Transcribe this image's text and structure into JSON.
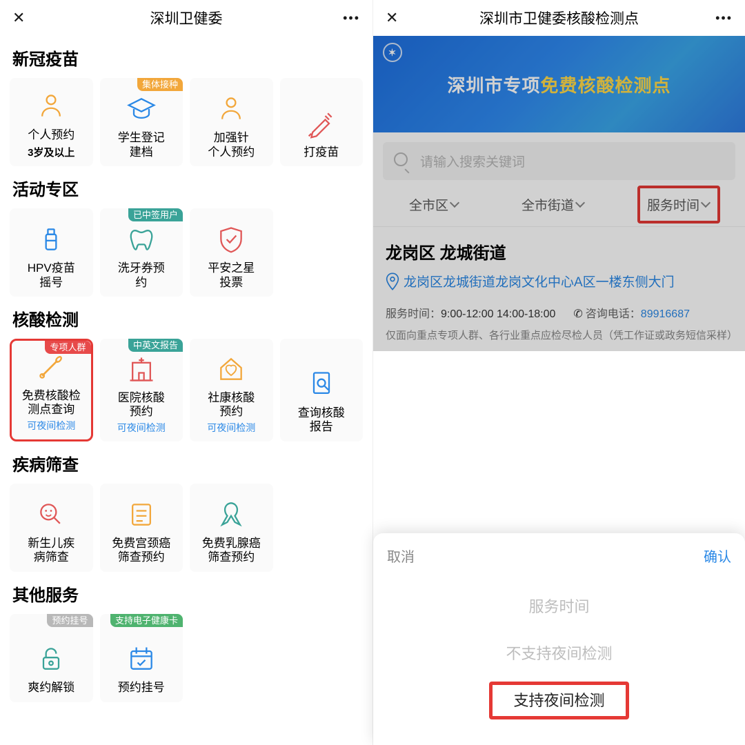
{
  "left": {
    "title": "深圳卫健委",
    "sections": [
      {
        "title": "新冠疫苗",
        "tiles": [
          {
            "id": "personal-appoint",
            "l1": "个人预约",
            "l2": "",
            "sub": "3岁及以上",
            "badge": null,
            "icon": "person",
            "iconColor": "#f2a73b"
          },
          {
            "id": "student-reg",
            "l1": "学生登记",
            "l2": "建档",
            "badge": "集体接种",
            "badgeColor": "orange",
            "icon": "gradhat",
            "iconColor": "#2a88e6"
          },
          {
            "id": "booster-appoint",
            "l1": "加强针",
            "l2": "个人预约",
            "badge": null,
            "icon": "person",
            "iconColor": "#f2a73b"
          },
          {
            "id": "vaccinate",
            "l1": "打疫苗",
            "l2": "",
            "badge": null,
            "icon": "syringe",
            "iconColor": "#e05757"
          }
        ]
      },
      {
        "title": "活动专区",
        "tiles": [
          {
            "id": "hpv-lottery",
            "l1": "HPV疫苗",
            "l2": "摇号",
            "badge": null,
            "icon": "bottle",
            "iconColor": "#2a88e6"
          },
          {
            "id": "dental-appoint",
            "l1": "洗牙券预",
            "l2": "约",
            "badge": "已中签用户",
            "badgeColor": "teal",
            "icon": "tooth",
            "iconColor": "#3aa398"
          },
          {
            "id": "pingan-vote",
            "l1": "平安之星",
            "l2": "投票",
            "badge": null,
            "icon": "shield",
            "iconColor": "#e05757"
          }
        ]
      },
      {
        "title": "核酸检测",
        "tiles": [
          {
            "id": "free-test-lookup",
            "l1": "免费核酸检",
            "l2": "测点查询",
            "note": "可夜间检测",
            "badge": "专项人群",
            "badgeColor": "red",
            "icon": "swab",
            "iconColor": "#f2a73b",
            "highlight": true
          },
          {
            "id": "hospital-test",
            "l1": "医院核酸",
            "l2": "预约",
            "note": "可夜间检测",
            "badge": "中英文报告",
            "badgeColor": "teal",
            "icon": "hospital",
            "iconColor": "#e05757"
          },
          {
            "id": "community-test",
            "l1": "社康核酸",
            "l2": "预约",
            "note": "可夜间检测",
            "badge": null,
            "icon": "house-heart",
            "iconColor": "#f2a73b"
          },
          {
            "id": "query-report",
            "l1": "查询核酸",
            "l2": "报告",
            "badge": null,
            "icon": "doc-search",
            "iconColor": "#2a88e6"
          }
        ]
      },
      {
        "title": "疾病筛查",
        "tiles": [
          {
            "id": "newborn-screen",
            "l1": "新生儿疾",
            "l2": "病筛查",
            "badge": null,
            "icon": "baby-search",
            "iconColor": "#e05757"
          },
          {
            "id": "cervical-screen",
            "l1": "免费宫颈癌",
            "l2": "筛查预约",
            "badge": null,
            "icon": "form",
            "iconColor": "#f2a73b"
          },
          {
            "id": "breast-screen",
            "l1": "免费乳腺癌",
            "l2": "筛查预约",
            "badge": null,
            "icon": "ribbon",
            "iconColor": "#3aa398"
          }
        ]
      },
      {
        "title": "其他服务",
        "tiles": [
          {
            "id": "unlock",
            "l1": "爽约解锁",
            "l2": "",
            "badge": "预约挂号",
            "badgeColor": "gray",
            "icon": "lock",
            "iconColor": "#3aa398"
          },
          {
            "id": "register",
            "l1": "预约挂号",
            "l2": "",
            "badge": "支持电子健康卡",
            "badgeColor": "green",
            "icon": "calendar",
            "iconColor": "#2a88e6"
          }
        ]
      }
    ]
  },
  "right": {
    "title": "深圳市卫健委核酸检测点",
    "hero_prefix": "深圳市专项",
    "hero_highlight": "免费核酸检测点",
    "search_placeholder": "请输入搜索关键词",
    "filters": [
      {
        "id": "district",
        "label": "全市区"
      },
      {
        "id": "street",
        "label": "全市街道"
      },
      {
        "id": "service-time",
        "label": "服务时间",
        "highlight": true
      }
    ],
    "result": {
      "heading": "龙岗区 龙城街道",
      "address": "龙岗区龙城街道龙岗文化中心A区一楼东侧大门",
      "service_label": "服务时间：",
      "service_value": "9:00-12:00 14:00-18:00",
      "phone_label": "咨询电话：",
      "phone_value": "89916687",
      "note": "仅面向重点专项人群、各行业重点应检尽检人员（凭工作证或政务短信采样）"
    },
    "sheet": {
      "cancel": "取消",
      "confirm": "确认",
      "options": [
        "服务时间",
        "不支持夜间检测",
        "支持夜间检测"
      ],
      "active_index": 2
    }
  }
}
